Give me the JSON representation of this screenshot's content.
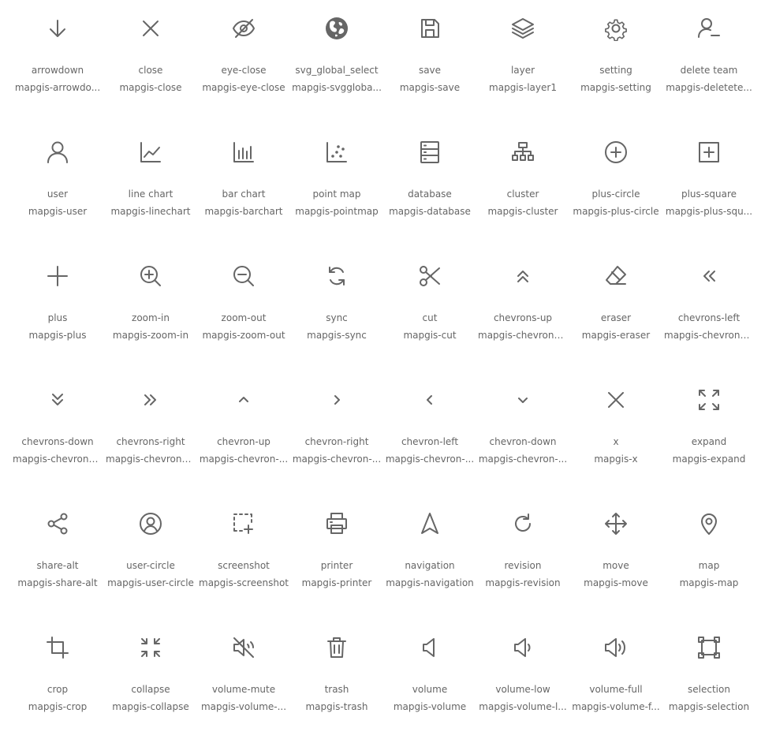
{
  "colors": {
    "icon": "#666666",
    "text": "#666666",
    "background": "#ffffff"
  },
  "icons": [
    {
      "label": "arrowdown",
      "code": "mapgis-arrowdo...",
      "icon": "arrow-down-icon"
    },
    {
      "label": "close",
      "code": "mapgis-close",
      "icon": "close-icon"
    },
    {
      "label": "eye-close",
      "code": "mapgis-eye-close",
      "icon": "eye-close-icon"
    },
    {
      "label": "svg_global_select",
      "code": "mapgis-svggloba...",
      "icon": "globe-icon"
    },
    {
      "label": "save",
      "code": "mapgis-save",
      "icon": "save-icon"
    },
    {
      "label": "layer",
      "code": "mapgis-layer1",
      "icon": "layer-icon"
    },
    {
      "label": "setting",
      "code": "mapgis-setting",
      "icon": "gear-icon"
    },
    {
      "label": "delete team",
      "code": "mapgis-deletete...",
      "icon": "user-minus-icon"
    },
    {
      "label": "user",
      "code": "mapgis-user",
      "icon": "user-icon"
    },
    {
      "label": "line chart",
      "code": "mapgis-linechart",
      "icon": "line-chart-icon"
    },
    {
      "label": "bar chart",
      "code": "mapgis-barchart",
      "icon": "bar-chart-icon"
    },
    {
      "label": "point map",
      "code": "mapgis-pointmap",
      "icon": "point-map-icon"
    },
    {
      "label": "database",
      "code": "mapgis-database",
      "icon": "database-icon"
    },
    {
      "label": "cluster",
      "code": "mapgis-cluster",
      "icon": "cluster-icon"
    },
    {
      "label": "plus-circle",
      "code": "mapgis-plus-circle",
      "icon": "plus-circle-icon"
    },
    {
      "label": "plus-square",
      "code": "mapgis-plus-squ...",
      "icon": "plus-square-icon"
    },
    {
      "label": "plus",
      "code": "mapgis-plus",
      "icon": "plus-icon"
    },
    {
      "label": "zoom-in",
      "code": "mapgis-zoom-in",
      "icon": "zoom-in-icon"
    },
    {
      "label": "zoom-out",
      "code": "mapgis-zoom-out",
      "icon": "zoom-out-icon"
    },
    {
      "label": "sync",
      "code": "mapgis-sync",
      "icon": "sync-icon"
    },
    {
      "label": "cut",
      "code": "mapgis-cut",
      "icon": "scissors-icon"
    },
    {
      "label": "chevrons-up",
      "code": "mapgis-chevrons...",
      "icon": "chevrons-up-icon"
    },
    {
      "label": "eraser",
      "code": "mapgis-eraser",
      "icon": "eraser-icon"
    },
    {
      "label": "chevrons-left",
      "code": "mapgis-chevrons...",
      "icon": "chevrons-left-icon"
    },
    {
      "label": "chevrons-down",
      "code": "mapgis-chevrons...",
      "icon": "chevrons-down-icon"
    },
    {
      "label": "chevrons-right",
      "code": "mapgis-chevrons...",
      "icon": "chevrons-right-icon"
    },
    {
      "label": "chevron-up",
      "code": "mapgis-chevron-...",
      "icon": "chevron-up-icon"
    },
    {
      "label": "chevron-right",
      "code": "mapgis-chevron-...",
      "icon": "chevron-right-icon"
    },
    {
      "label": "chevron-left",
      "code": "mapgis-chevron-...",
      "icon": "chevron-left-icon"
    },
    {
      "label": "chevron-down",
      "code": "mapgis-chevron-...",
      "icon": "chevron-down-icon"
    },
    {
      "label": "x",
      "code": "mapgis-x",
      "icon": "x-icon"
    },
    {
      "label": "expand",
      "code": "mapgis-expand",
      "icon": "expand-icon"
    },
    {
      "label": "share-alt",
      "code": "mapgis-share-alt",
      "icon": "share-icon"
    },
    {
      "label": "user-circle",
      "code": "mapgis-user-circle",
      "icon": "user-circle-icon"
    },
    {
      "label": "screenshot",
      "code": "mapgis-screenshot",
      "icon": "screenshot-icon"
    },
    {
      "label": "printer",
      "code": "mapgis-printer",
      "icon": "printer-icon"
    },
    {
      "label": "navigation",
      "code": "mapgis-navigation",
      "icon": "navigation-icon"
    },
    {
      "label": "revision",
      "code": "mapgis-revision",
      "icon": "revision-icon"
    },
    {
      "label": "move",
      "code": "mapgis-move",
      "icon": "move-icon"
    },
    {
      "label": "map",
      "code": "mapgis-map",
      "icon": "map-pin-icon"
    },
    {
      "label": "crop",
      "code": "mapgis-crop",
      "icon": "crop-icon"
    },
    {
      "label": "collapse",
      "code": "mapgis-collapse",
      "icon": "collapse-icon"
    },
    {
      "label": "volume-mute",
      "code": "mapgis-volume-...",
      "icon": "volume-mute-icon"
    },
    {
      "label": "trash",
      "code": "mapgis-trash",
      "icon": "trash-icon"
    },
    {
      "label": "volume",
      "code": "mapgis-volume",
      "icon": "volume-icon"
    },
    {
      "label": "volume-low",
      "code": "mapgis-volume-l...",
      "icon": "volume-low-icon"
    },
    {
      "label": "volume-full",
      "code": "mapgis-volume-f...",
      "icon": "volume-full-icon"
    },
    {
      "label": "selection",
      "code": "mapgis-selection",
      "icon": "selection-icon"
    }
  ]
}
